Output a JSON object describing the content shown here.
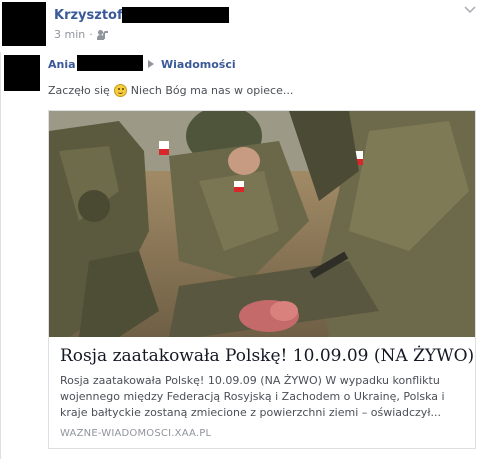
{
  "post": {
    "author_name": "Krzysztof J",
    "time": "3 min",
    "separator": "·",
    "audience_icon": "friends-icon",
    "menu_icon": "chevron-down-icon"
  },
  "shared": {
    "sharer_name": "Ania",
    "target_name": "Wiadomości",
    "text_before": "Zaczęło się",
    "emoji": "smiley-icon",
    "text_after": "Niech Bóg ma nas w opiece..."
  },
  "link": {
    "title": "Rosja zaatakowała Polskę! 10.09.09 (NA ŻYWO)",
    "description_lines": [
      "Rosja zaatakowała Polskę! 10.09.09 (NA ŻYWO) W wypadku konfliktu",
      "wojennego między Federacją Rosyjską i Zachodem o Ukrainę, Polska i",
      "kraje bałtyckie zostaną zmiecione z powierzchni ziemi – oświadczył..."
    ],
    "domain": "WAZNE-WIADOMOSCI.XAA.PL"
  },
  "colors": {
    "link_blue": "#3b5998",
    "meta_gray": "#90949c",
    "text_gray": "#4b4f56",
    "border": "#dddfe2"
  }
}
